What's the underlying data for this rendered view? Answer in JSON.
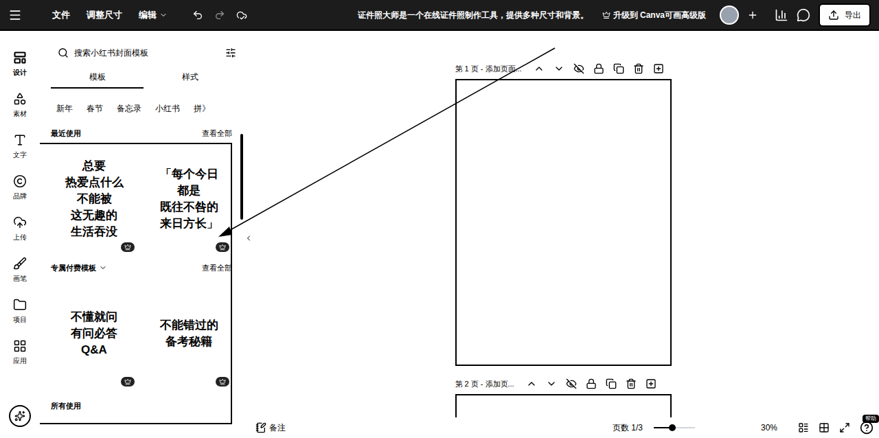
{
  "topbar": {
    "menus": [
      {
        "label": "文件",
        "dropdown": false
      },
      {
        "label": "调整尺寸",
        "dropdown": false
      },
      {
        "label": "编辑",
        "dropdown": true
      }
    ],
    "title": "证件照大师是一个在线证件照制作工具，提供多种尺寸和背景。",
    "upgrade": "升级到 Canva可画高级版",
    "export": "导出"
  },
  "rail": [
    {
      "label": "设计",
      "selected": true
    },
    {
      "label": "素材",
      "selected": false
    },
    {
      "label": "文字",
      "selected": false
    },
    {
      "label": "品牌",
      "selected": false
    },
    {
      "label": "上传",
      "selected": false
    },
    {
      "label": "画笔",
      "selected": false
    },
    {
      "label": "项目",
      "selected": false
    },
    {
      "label": "应用",
      "selected": false
    }
  ],
  "panel": {
    "search_placeholder": "搜索小红书封面模板",
    "tabs": [
      {
        "label": "模板",
        "selected": true
      },
      {
        "label": "样式",
        "selected": false
      }
    ],
    "chips": [
      "新年",
      "春节",
      "备忘录",
      "小红书",
      "拼》"
    ],
    "sections": [
      {
        "title": "最近使用",
        "dropdown": false,
        "view_all": "查看全部",
        "templates": [
          {
            "lines": [
              "总要",
              "热爱点什么",
              "不能被",
              "这无趣的",
              "生活吞没"
            ],
            "premium": true
          },
          {
            "lines": [
              "「每个今日",
              "都是",
              "既往不咎的",
              "来日方长」"
            ],
            "premium": true
          }
        ]
      },
      {
        "title": "专属付费模板",
        "dropdown": true,
        "view_all": "查看全部",
        "templates": [
          {
            "lines": [
              "不懂就问",
              "有问必答",
              "Q&A"
            ],
            "premium": true
          },
          {
            "lines": [
              "不能错过的",
              "备考秘籍"
            ],
            "premium": true
          }
        ]
      }
    ],
    "next_section": "所有使用"
  },
  "pages": [
    {
      "label": "第 1 页 - 添加页面..."
    },
    {
      "label": "第 2 页 - 添加页..."
    }
  ],
  "bottom": {
    "notes": "备注",
    "page_count": "页数 1/3",
    "zoom_level": 0.45,
    "zoom": "30%",
    "help": "帮助"
  }
}
